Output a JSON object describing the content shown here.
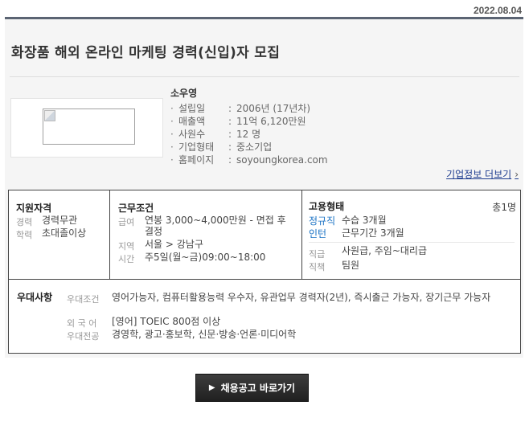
{
  "header": {
    "date": "2022.08.04"
  },
  "job": {
    "title": "화장품 해외 온라인 마케팅 경력(신입)자 모집"
  },
  "company": {
    "name": "소우영",
    "logo_icon": "broken-image-icon",
    "info": [
      {
        "key": "설립일",
        "value": "2006년 (17년차)"
      },
      {
        "key": "매출액",
        "value": "11억 6,120만원"
      },
      {
        "key": "사원수",
        "value": "12 명"
      },
      {
        "key": "기업형태",
        "value": "중소기업"
      },
      {
        "key": "홈페이지",
        "value": "soyoungkorea.com"
      }
    ],
    "more_label": "기업정보 더보기",
    "more_icon": "chevron-right-icon"
  },
  "qualification": {
    "heading": "지원자격",
    "career_label": "경력",
    "career": "경력무관",
    "edu_label": "학력",
    "edu": "초대졸이상"
  },
  "conditions": {
    "heading": "근무조건",
    "salary_label": "급여",
    "salary": "연봉 3,000~4,000만원 - 면접 후 결정",
    "region_label": "지역",
    "region": "서울 > 강남구",
    "time_label": "시간",
    "time": "주5일(월~금)09:00~18:00"
  },
  "employment": {
    "heading": "고용형태",
    "count": "총1명",
    "types": [
      {
        "type": "정규직",
        "detail": "수습 3개월"
      },
      {
        "type": "인턴",
        "detail": "근무기간 3개월"
      }
    ],
    "rank_label": "직급",
    "rank": "사원급, 주임~대리급",
    "duty_label": "직책",
    "duty": "팀원"
  },
  "preferences": {
    "heading": "우대사항",
    "cond_label": "우대조건",
    "cond": "영어가능자, 컴퓨터활용능력 우수자, 유관업무 경력자(2년), 즉시출근 가능자, 장기근무 가능자",
    "lang_label": "외 국 어",
    "lang": "[영어] TOEIC 800점 이상",
    "major_label": "우대전공",
    "major": "경영학, 광고·홍보학, 신문·방송·언론·미디어학"
  },
  "cta": {
    "label": "채용공고 바로가기",
    "icon": "caret-right-icon"
  }
}
